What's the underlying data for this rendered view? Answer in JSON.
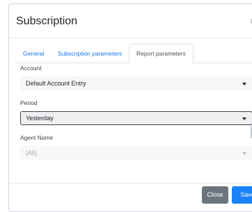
{
  "modal": {
    "title": "Subscription",
    "close_glyph": "×"
  },
  "tabs": [
    {
      "label": "General",
      "active": false
    },
    {
      "label": "Subscription parameters",
      "active": false
    },
    {
      "label": "Report parameters",
      "active": true
    }
  ],
  "fields": {
    "account": {
      "label": "Account",
      "value": "Default Account Entry"
    },
    "period": {
      "label": "Period",
      "value": "Yesterday"
    },
    "agent_name": {
      "label": "Agent Name",
      "value": "(All)",
      "disabled": true
    }
  },
  "footer": {
    "close_label": "Close",
    "save_label": "Save"
  },
  "colors": {
    "accent": "#1a82f7",
    "secondary_button": "#6c757d",
    "tab_link": "#1a73e8"
  },
  "icons": {
    "dismiss": "close-icon",
    "dropdown": "caret-down-icon"
  }
}
